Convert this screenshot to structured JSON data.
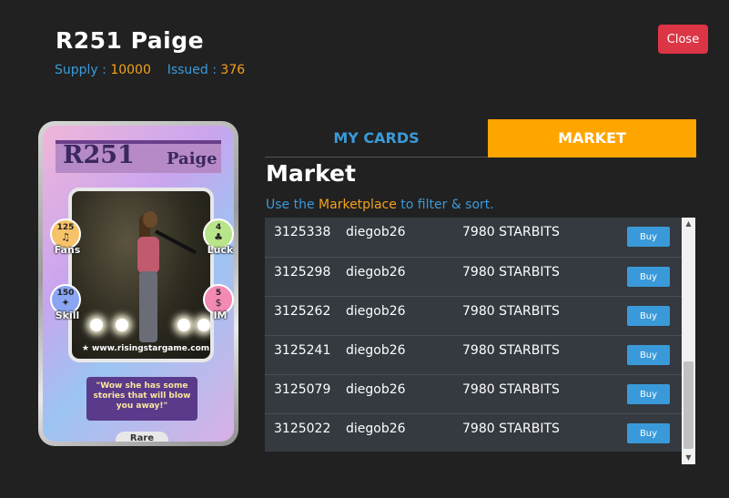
{
  "header": {
    "title": "R251 Paige",
    "supply_label": "Supply :",
    "supply_value": "10000",
    "issued_label": "Issued :",
    "issued_value": "376",
    "close_label": "Close"
  },
  "card": {
    "code": "R251",
    "name": "Paige",
    "website": "www.risingstargame.com",
    "quote": "\"Wow she has some stories that will blow you away!\"",
    "rarity": "Rare",
    "stats": {
      "fans": {
        "value": "125",
        "label": "Fans"
      },
      "luck": {
        "value": "4",
        "label": "Luck"
      },
      "skill": {
        "value": "150",
        "label": "Skill"
      },
      "im": {
        "value": "5",
        "label": "IM"
      }
    }
  },
  "tabs": {
    "my_cards": "MY CARDS",
    "market": "MARKET",
    "active": "MARKET"
  },
  "market": {
    "heading": "Market",
    "desc_pre": "Use the",
    "desc_link": "Marketplace",
    "desc_post": "to filter & sort.",
    "listings": [
      {
        "id": "3125338",
        "seller": "diegob26",
        "price": "7980 STARBITS",
        "action": "Buy"
      },
      {
        "id": "3125298",
        "seller": "diegob26",
        "price": "7980 STARBITS",
        "action": "Buy"
      },
      {
        "id": "3125262",
        "seller": "diegob26",
        "price": "7980 STARBITS",
        "action": "Buy"
      },
      {
        "id": "3125241",
        "seller": "diegob26",
        "price": "7980 STARBITS",
        "action": "Buy"
      },
      {
        "id": "3125079",
        "seller": "diegob26",
        "price": "7980 STARBITS",
        "action": "Buy"
      },
      {
        "id": "3125022",
        "seller": "diegob26",
        "price": "7980 STARBITS",
        "action": "Buy"
      }
    ]
  },
  "colors": {
    "accent_blue": "#3a9ad9",
    "accent_orange": "#ffa500",
    "close_red": "#dc3545"
  }
}
